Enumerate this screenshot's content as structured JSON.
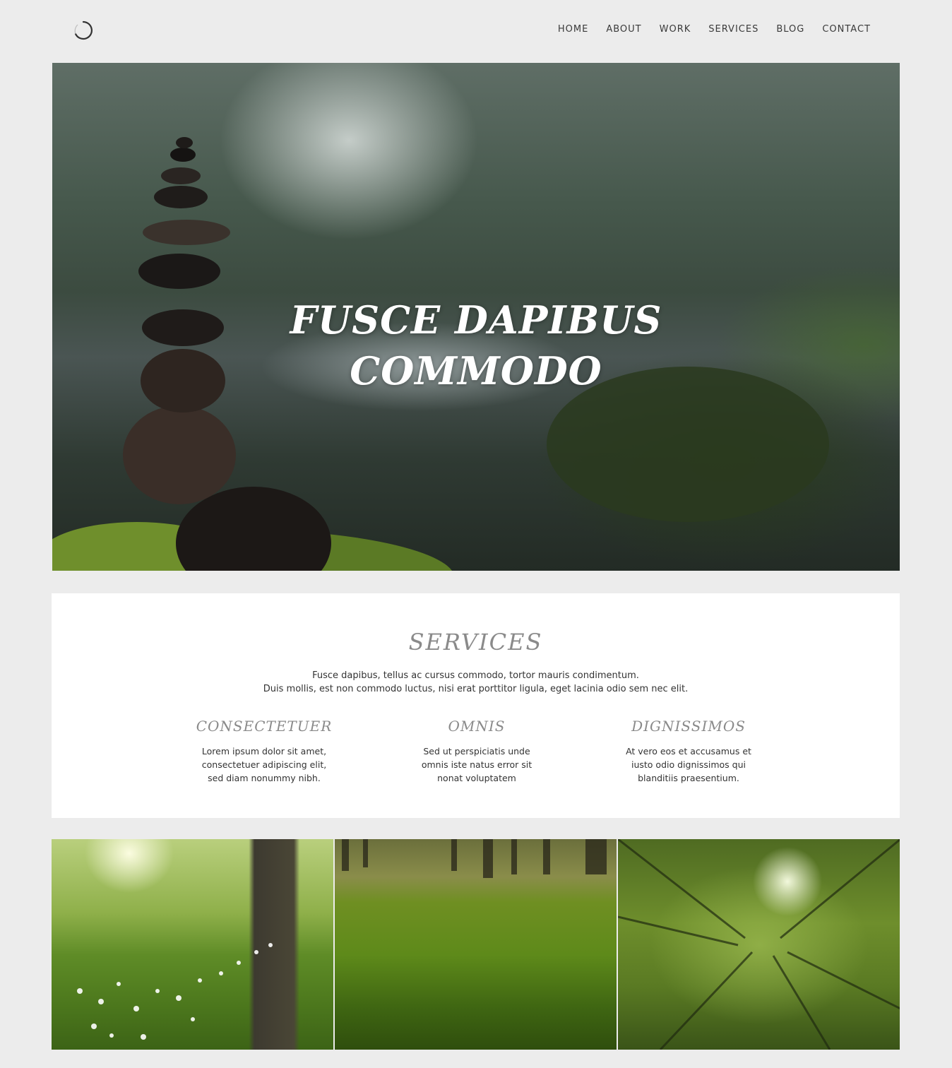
{
  "header": {
    "logo_icon": "circle-loader-icon",
    "nav": [
      "HOME",
      "ABOUT",
      "WORK",
      "SERVICES",
      "BLOG",
      "CONTACT"
    ]
  },
  "hero": {
    "title_line1": "FUSCE DAPIBUS",
    "title_line2": "COMMODO",
    "image": "stone-cairn-forest-river-photo"
  },
  "services": {
    "title": "SERVICES",
    "intro_line1": "Fusce dapibus, tellus ac cursus commodo, tortor mauris condimentum.",
    "intro_line2": "Duis mollis, est non commodo luctus, nisi erat porttitor ligula, eget lacinia odio sem nec elit.",
    "columns": [
      {
        "heading": "CONSECTETUER",
        "lines": [
          "Lorem ipsum dolor sit amet,",
          "consectetuer adipiscing elit,",
          "sed diam nonummy nibh."
        ]
      },
      {
        "heading": "OMNIS",
        "lines": [
          "Sed ut perspiciatis unde",
          "omnis iste natus error sit",
          "nonat voluptatem"
        ]
      },
      {
        "heading": "DIGNISSIMOS",
        "lines": [
          "At vero eos et accusamus et",
          "iusto odio dignissimos qui",
          "blanditiis praesentium."
        ]
      }
    ]
  },
  "gallery": [
    "sunlit-meadow-tree-photo",
    "mossy-forest-floor-photo",
    "forest-canopy-photo"
  ]
}
